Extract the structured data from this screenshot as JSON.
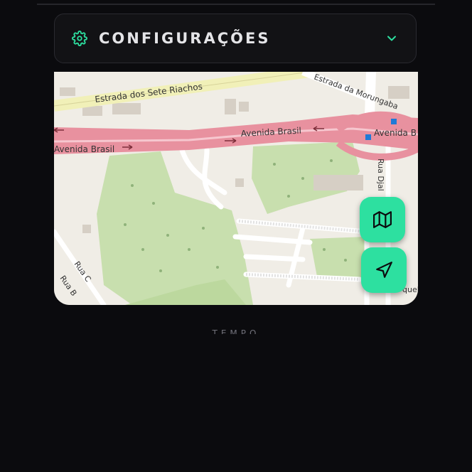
{
  "settings": {
    "title": "CONFIGURAÇÕES",
    "icon": "gear-icon",
    "toggle_icon": "chevron-down-icon",
    "accent_color": "#2de0a0"
  },
  "map": {
    "labels": {
      "road_top": "Estrada dos Sete Riachos",
      "road_top_right": "Estrada da Morungaba",
      "avenue_center": "Avenida Brasil",
      "avenue_left": "Avenida Brasil",
      "avenue_right": "Avenida B",
      "street_vertical": "Rua Djal",
      "street_c": "Rua C",
      "street_b": "Rua B",
      "street_bottom_right": "quel"
    },
    "buttons": {
      "map_icon": "map-icon",
      "navigate_icon": "navigation-arrow-icon"
    }
  },
  "section_next": {
    "label": "TEMPO"
  }
}
